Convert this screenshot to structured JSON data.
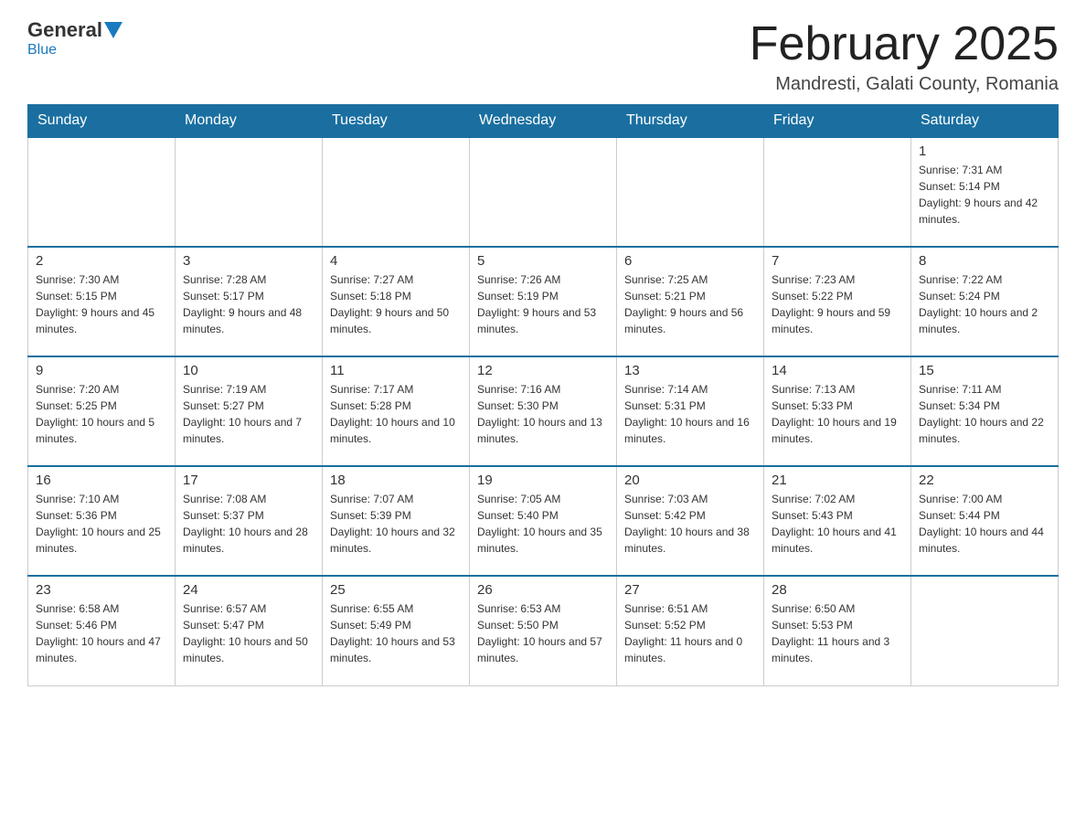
{
  "logo": {
    "text_general": "General",
    "text_blue": "Blue"
  },
  "header": {
    "month_title": "February 2025",
    "location": "Mandresti, Galati County, Romania"
  },
  "days_of_week": [
    "Sunday",
    "Monday",
    "Tuesday",
    "Wednesday",
    "Thursday",
    "Friday",
    "Saturday"
  ],
  "weeks": [
    {
      "days": [
        {
          "date": "",
          "info": ""
        },
        {
          "date": "",
          "info": ""
        },
        {
          "date": "",
          "info": ""
        },
        {
          "date": "",
          "info": ""
        },
        {
          "date": "",
          "info": ""
        },
        {
          "date": "",
          "info": ""
        },
        {
          "date": "1",
          "info": "Sunrise: 7:31 AM\nSunset: 5:14 PM\nDaylight: 9 hours and 42 minutes."
        }
      ]
    },
    {
      "days": [
        {
          "date": "2",
          "info": "Sunrise: 7:30 AM\nSunset: 5:15 PM\nDaylight: 9 hours and 45 minutes."
        },
        {
          "date": "3",
          "info": "Sunrise: 7:28 AM\nSunset: 5:17 PM\nDaylight: 9 hours and 48 minutes."
        },
        {
          "date": "4",
          "info": "Sunrise: 7:27 AM\nSunset: 5:18 PM\nDaylight: 9 hours and 50 minutes."
        },
        {
          "date": "5",
          "info": "Sunrise: 7:26 AM\nSunset: 5:19 PM\nDaylight: 9 hours and 53 minutes."
        },
        {
          "date": "6",
          "info": "Sunrise: 7:25 AM\nSunset: 5:21 PM\nDaylight: 9 hours and 56 minutes."
        },
        {
          "date": "7",
          "info": "Sunrise: 7:23 AM\nSunset: 5:22 PM\nDaylight: 9 hours and 59 minutes."
        },
        {
          "date": "8",
          "info": "Sunrise: 7:22 AM\nSunset: 5:24 PM\nDaylight: 10 hours and 2 minutes."
        }
      ]
    },
    {
      "days": [
        {
          "date": "9",
          "info": "Sunrise: 7:20 AM\nSunset: 5:25 PM\nDaylight: 10 hours and 5 minutes."
        },
        {
          "date": "10",
          "info": "Sunrise: 7:19 AM\nSunset: 5:27 PM\nDaylight: 10 hours and 7 minutes."
        },
        {
          "date": "11",
          "info": "Sunrise: 7:17 AM\nSunset: 5:28 PM\nDaylight: 10 hours and 10 minutes."
        },
        {
          "date": "12",
          "info": "Sunrise: 7:16 AM\nSunset: 5:30 PM\nDaylight: 10 hours and 13 minutes."
        },
        {
          "date": "13",
          "info": "Sunrise: 7:14 AM\nSunset: 5:31 PM\nDaylight: 10 hours and 16 minutes."
        },
        {
          "date": "14",
          "info": "Sunrise: 7:13 AM\nSunset: 5:33 PM\nDaylight: 10 hours and 19 minutes."
        },
        {
          "date": "15",
          "info": "Sunrise: 7:11 AM\nSunset: 5:34 PM\nDaylight: 10 hours and 22 minutes."
        }
      ]
    },
    {
      "days": [
        {
          "date": "16",
          "info": "Sunrise: 7:10 AM\nSunset: 5:36 PM\nDaylight: 10 hours and 25 minutes."
        },
        {
          "date": "17",
          "info": "Sunrise: 7:08 AM\nSunset: 5:37 PM\nDaylight: 10 hours and 28 minutes."
        },
        {
          "date": "18",
          "info": "Sunrise: 7:07 AM\nSunset: 5:39 PM\nDaylight: 10 hours and 32 minutes."
        },
        {
          "date": "19",
          "info": "Sunrise: 7:05 AM\nSunset: 5:40 PM\nDaylight: 10 hours and 35 minutes."
        },
        {
          "date": "20",
          "info": "Sunrise: 7:03 AM\nSunset: 5:42 PM\nDaylight: 10 hours and 38 minutes."
        },
        {
          "date": "21",
          "info": "Sunrise: 7:02 AM\nSunset: 5:43 PM\nDaylight: 10 hours and 41 minutes."
        },
        {
          "date": "22",
          "info": "Sunrise: 7:00 AM\nSunset: 5:44 PM\nDaylight: 10 hours and 44 minutes."
        }
      ]
    },
    {
      "days": [
        {
          "date": "23",
          "info": "Sunrise: 6:58 AM\nSunset: 5:46 PM\nDaylight: 10 hours and 47 minutes."
        },
        {
          "date": "24",
          "info": "Sunrise: 6:57 AM\nSunset: 5:47 PM\nDaylight: 10 hours and 50 minutes."
        },
        {
          "date": "25",
          "info": "Sunrise: 6:55 AM\nSunset: 5:49 PM\nDaylight: 10 hours and 53 minutes."
        },
        {
          "date": "26",
          "info": "Sunrise: 6:53 AM\nSunset: 5:50 PM\nDaylight: 10 hours and 57 minutes."
        },
        {
          "date": "27",
          "info": "Sunrise: 6:51 AM\nSunset: 5:52 PM\nDaylight: 11 hours and 0 minutes."
        },
        {
          "date": "28",
          "info": "Sunrise: 6:50 AM\nSunset: 5:53 PM\nDaylight: 11 hours and 3 minutes."
        },
        {
          "date": "",
          "info": ""
        }
      ]
    }
  ]
}
